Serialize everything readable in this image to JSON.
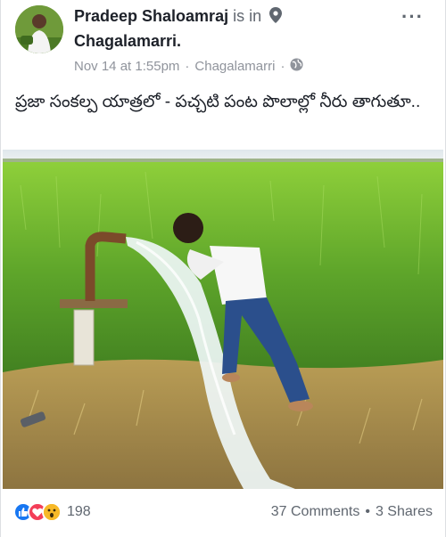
{
  "header": {
    "author": "Pradeep Shaloamraj",
    "is_in": "is in",
    "place": "Chagalamarri.",
    "date": "Nov 14 at 1:55pm",
    "separator": "·",
    "location": "Chagalamarri",
    "more": "···"
  },
  "post": {
    "text": "ప్రజా సంకల్ప యాత్రలో - పచ్చటి పంట పొలాల్లో నీరు తాగుతూ.."
  },
  "footer": {
    "reaction_count": "198",
    "comments": "37 Comments",
    "separator": "•",
    "shares": "3 Shares"
  },
  "icons": {
    "location": "location-pin-icon",
    "privacy": "globe-icon",
    "reactions": [
      "like-icon",
      "love-icon",
      "wow-icon"
    ]
  },
  "colors": {
    "author_text": "#1d2129",
    "meta_text": "#90949c",
    "like": "#1877f2",
    "love": "#f33e58",
    "wow": "#f7b928"
  }
}
